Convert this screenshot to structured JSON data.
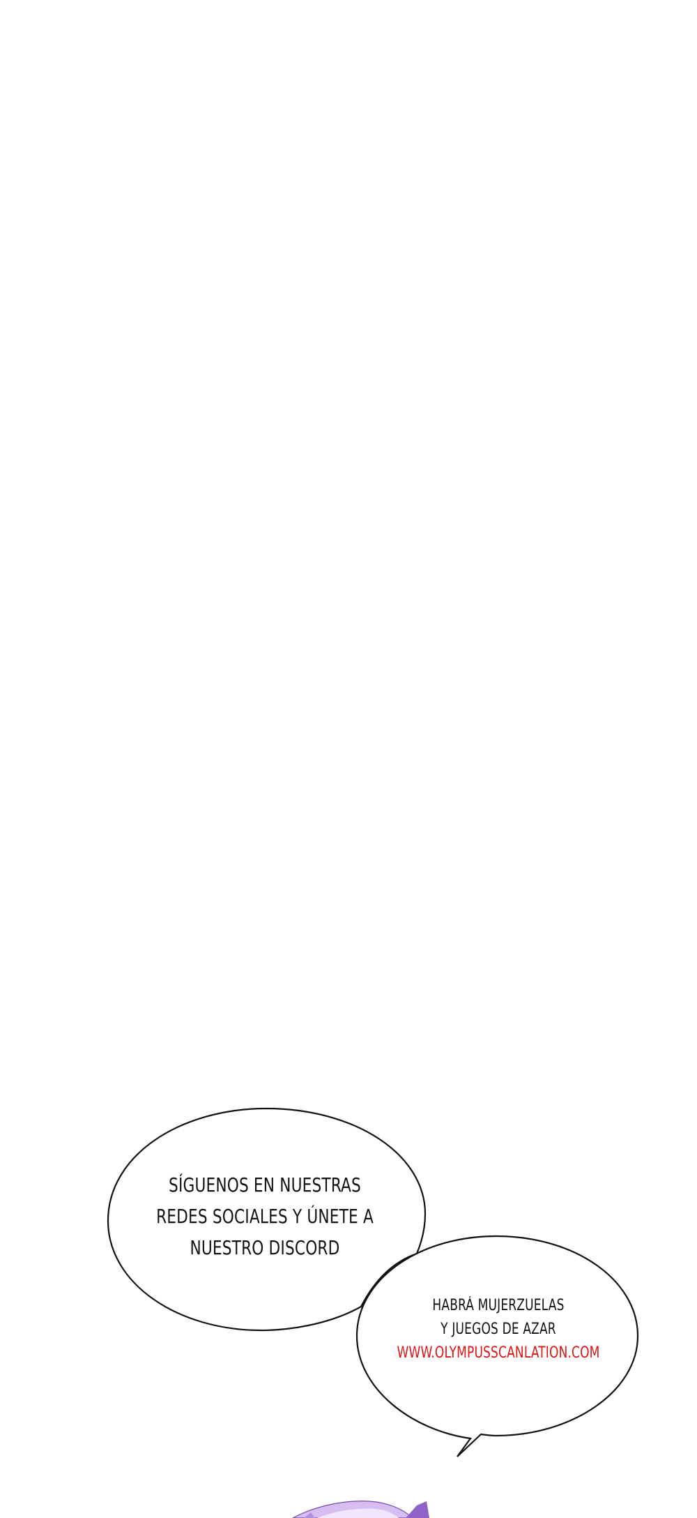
{
  "page": {
    "background": "#ffffff"
  },
  "bubble_1": {
    "lines": [
      "SÍGUENOS EN NUESTRAS",
      "REDES SOCIALES Y ÚNETE A",
      "NUESTRO DISCORD"
    ]
  },
  "bubble_2": {
    "lines": [
      "HABRÁ MUJERZUELAS",
      "Y JUEGOS DE AZAR"
    ],
    "url": "WWW.OLYMPUSSCANLATION.COM",
    "url_color": "#e21313"
  },
  "artwork": {
    "hair_color": "#c9a6e6",
    "hair_shadow": "#8e62c7"
  }
}
